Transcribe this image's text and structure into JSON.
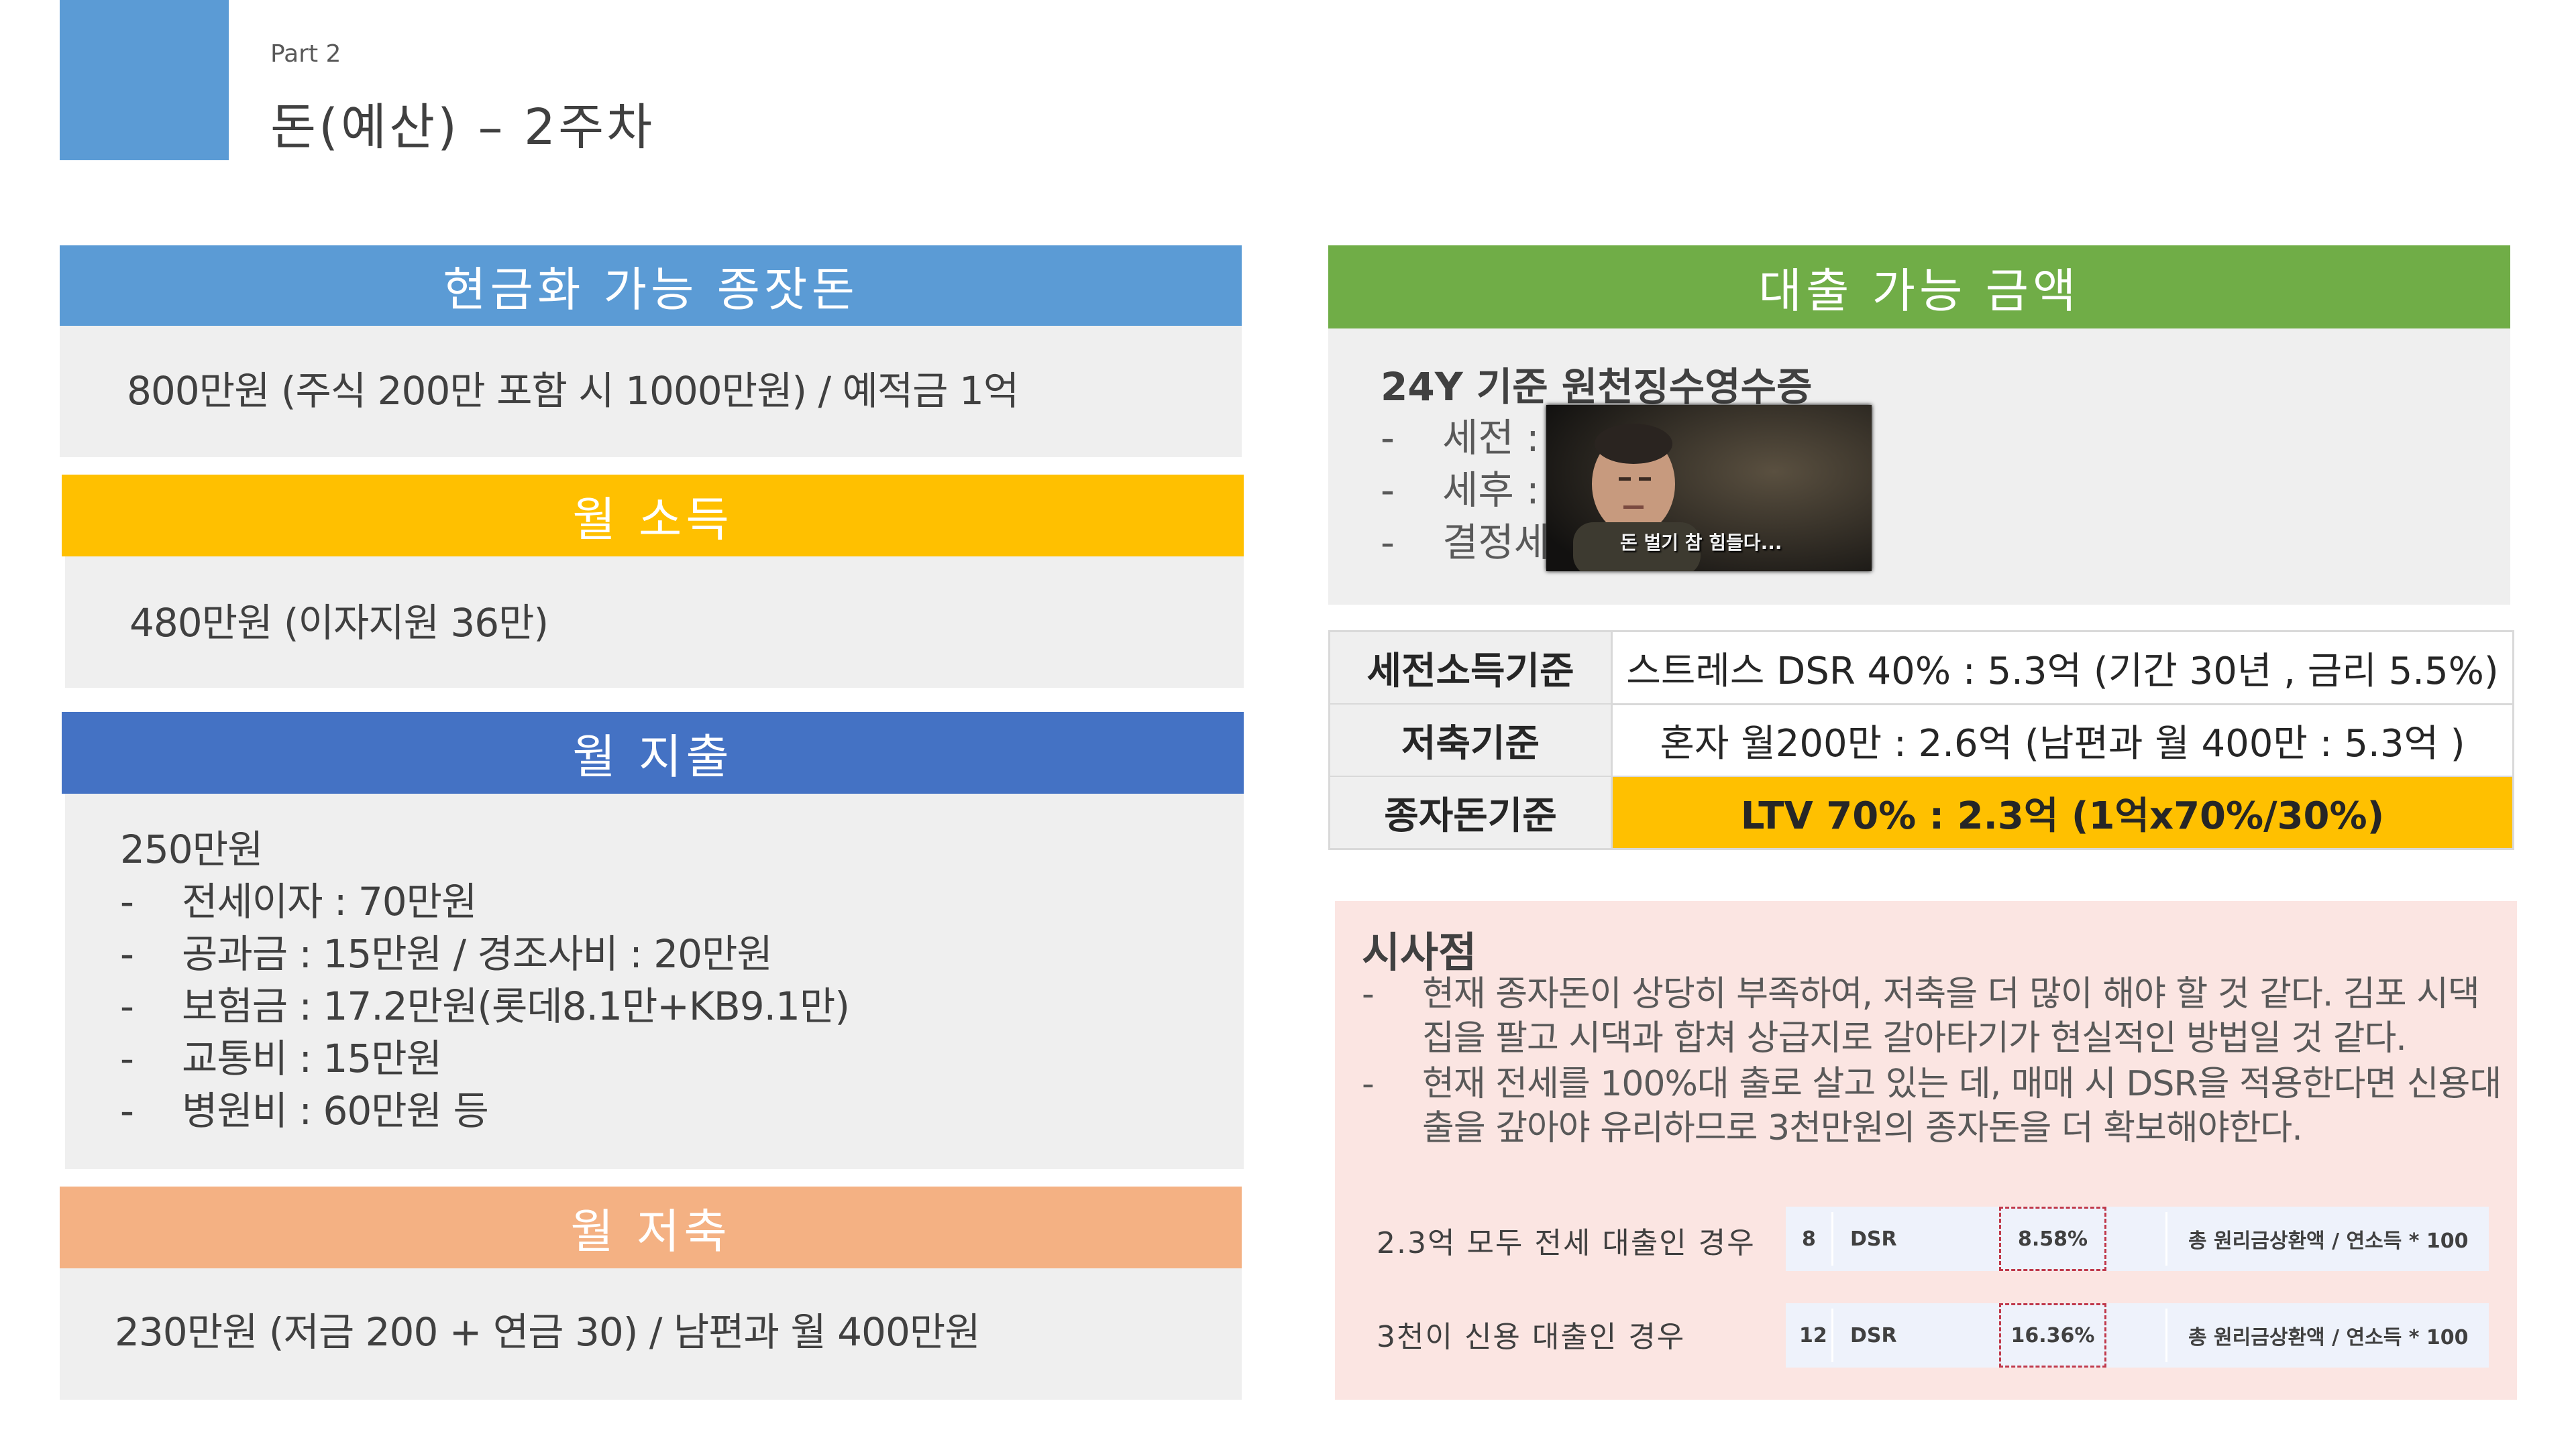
{
  "header": {
    "part": "Part 2",
    "title": "돈(예산) – 2주차"
  },
  "cash": {
    "title": "현금화 가능 종잣돈",
    "text": "800만원 (주식 200만 포함 시 1000만원) / 예적금 1억"
  },
  "income": {
    "title": "월 소득",
    "text": "480만원 (이자지원 36만)"
  },
  "expense": {
    "title": "월 지출",
    "total": "250만원",
    "items": [
      "전세이자 : 70만원",
      "공과금 : 15만원 / 경조사비 : 20만원",
      "보험금 : 17.2만원(롯데8.1만+KB9.1만)",
      "교통비 : 15만원",
      "병원비 : 60만원 등"
    ]
  },
  "saving": {
    "title": "월 저축",
    "text": "230만원 (저금 200 + 연금 30) / 남편과 월 400만원"
  },
  "loan": {
    "title": "대출 가능 금액",
    "subtitle": "24Y 기준 원천징수영수증",
    "items": [
      "세전 :",
      "세후 :",
      "결정세"
    ],
    "thumb_caption": "돈 벌기 참 힘들다..."
  },
  "table": {
    "rows": [
      {
        "label": "세전소득기준",
        "value": "스트레스 DSR 40% : 5.3억 (기간 30년 , 금리 5.5%)"
      },
      {
        "label": "저축기준",
        "value": "혼자 월200만 : 2.6억 (남편과 월 400만 : 5.3억 )"
      },
      {
        "label": "종자돈기준",
        "value": "LTV 70% : 2.3억 (1억x70%/30%)"
      }
    ]
  },
  "insight": {
    "title": "시사점",
    "points": [
      "현재 종자돈이 상당히 부족하여, 저축을 더 많이 해야 할 것 같다. 김포 시댁 집을 팔고 시댁과 합쳐 상급지로 갈아타기가 현실적인 방법일 것 같다.",
      "현재 전세를 100%대 출로 살고 있는 데, 매매 시 DSR을 적용한다면 신용대출을 갚아야 유리하므로 3천만원의 종자돈을 더 확보해야한다."
    ],
    "cases": [
      {
        "label": "2.3억 모두 전세 대출인 경우",
        "num": "8",
        "metric": "DSR",
        "value": "8.58%",
        "formula": "총 원리금상환액 / 연소득 * 100"
      },
      {
        "label": "3천이 신용 대출인 경우",
        "num": "12",
        "metric": "DSR",
        "value": "16.36%",
        "formula": "총 원리금상환액 / 연소득 * 100"
      }
    ]
  },
  "colors": {
    "blue": "#5b9bd5",
    "gold": "#ffc000",
    "dark_blue": "#4472c4",
    "orange": "#f4b183",
    "green": "#70ad47",
    "insight_bg": "#fbe5e2"
  }
}
